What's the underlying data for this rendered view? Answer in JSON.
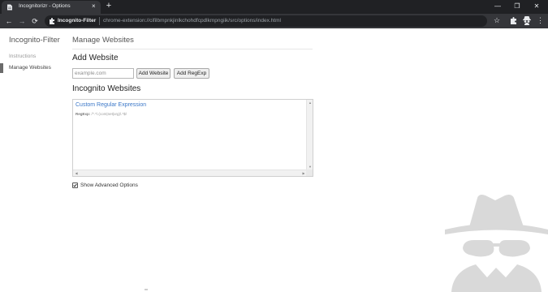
{
  "browser": {
    "tab_title": "Incognitorizr - Options",
    "tab_close": "×",
    "new_tab": "+",
    "window_controls": {
      "minimize": "—",
      "maximize": "❐",
      "close": "✕"
    },
    "nav": {
      "back": "←",
      "forward": "→",
      "reload": "⟳"
    },
    "omnibox": {
      "site_label": "Incognito-Filter",
      "url": "chrome-extension://cifilbmpnkjinlkchohdfcpdlkmpngiik/src/options/index.html"
    },
    "star": "☆",
    "menu": "⋮",
    "icons": {
      "tab_favicon": "document-icon",
      "omnibox_puzzle": "puzzle-icon",
      "extensions": "puzzle-icon",
      "profile_extension": "spy-icon"
    }
  },
  "sidebar": {
    "title": "Incognito-Filter",
    "items": [
      {
        "label": "Instructions",
        "active": false
      },
      {
        "label": "Manage Websites",
        "active": true
      }
    ]
  },
  "main": {
    "title": "Manage Websites",
    "add_section": {
      "heading": "Add Website",
      "input_value": "",
      "input_placeholder": "example.com",
      "add_button": "Add Website",
      "add_regexp_button": "Add RegExp"
    },
    "list_section": {
      "heading": "Incognito Websites",
      "items": [
        {
          "name": "Custom Regular Expression",
          "detail_label": "RegExp:",
          "detail_value": "/^.*\\.(com|net|org)\\.*$/"
        }
      ]
    },
    "advanced": {
      "label": "Show Advanced Options",
      "checked": true
    }
  },
  "colors": {
    "tabstrip": "#202124",
    "toolbar": "#35363a",
    "link_blue": "#3c78c8",
    "active_indicator": "#6b6b6b",
    "mascot_gray": "#d9d9d9"
  },
  "mascot": {
    "icon": "spy-incognito-icon"
  }
}
